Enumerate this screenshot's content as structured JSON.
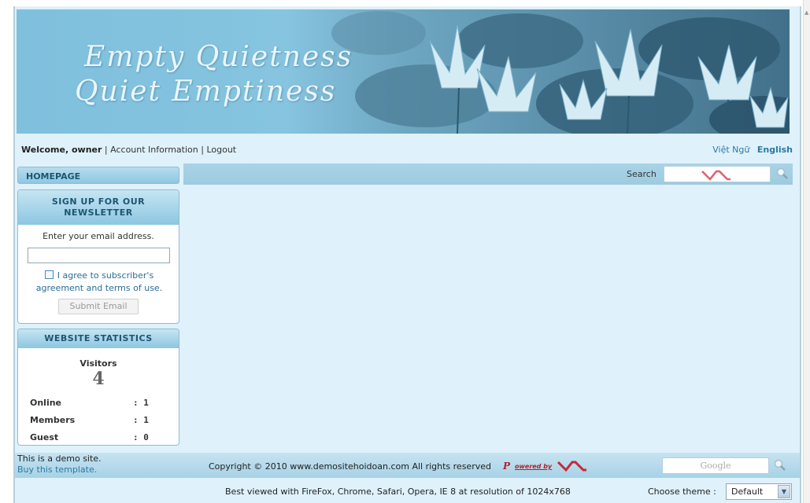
{
  "banner": {
    "title_line1": "Empty Quietness",
    "title_line2": "Quiet Emptiness"
  },
  "topbar": {
    "welcome_prefix": "Welcome, owner",
    "account_link": "Account Information",
    "separator": "|",
    "logout_link": "Logout",
    "lang_vn": "Việt Ngữ",
    "lang_en": "English"
  },
  "sidebar": {
    "homepage_label": "HOMEPAGE",
    "newsletter": {
      "heading_line1": "SIGN UP FOR OUR",
      "heading_line2": "NEWSLETTER",
      "prompt": "Enter your email address.",
      "email_value": "",
      "agree_line1": "I agree to subscriber's",
      "agree_line2": "agreement and terms of use.",
      "submit_label": "Submit Email"
    },
    "stats": {
      "heading": "WEBSITE STATISTICS",
      "visitors_label": "Visitors",
      "visitors_count": "4",
      "rows": [
        {
          "label": "Online",
          "value": ": 1"
        },
        {
          "label": "Members",
          "value": ": 1"
        },
        {
          "label": "Guest",
          "value": ": 0"
        }
      ]
    }
  },
  "main": {
    "search_label": "Search",
    "search_value": ""
  },
  "footer": {
    "demo_note": "This is a demo site.",
    "buy_link": "Buy this template.",
    "copyright": "Copyright © 2010 www.demositehoidoan.com All rights reserved",
    "powered_initial": "P",
    "powered_rest": "owered by",
    "google_placeholder": "Google",
    "best_viewed": "Best viewed with FireFox, Chrome, Safari, Opera, IE 8 at resolution of 1024x768",
    "theme_label": "Choose theme :",
    "theme_value": "Default"
  },
  "colors": {
    "page_bg": "#dff1fa",
    "accent": "#2b7aa3",
    "powered_red": "#b0202c"
  }
}
